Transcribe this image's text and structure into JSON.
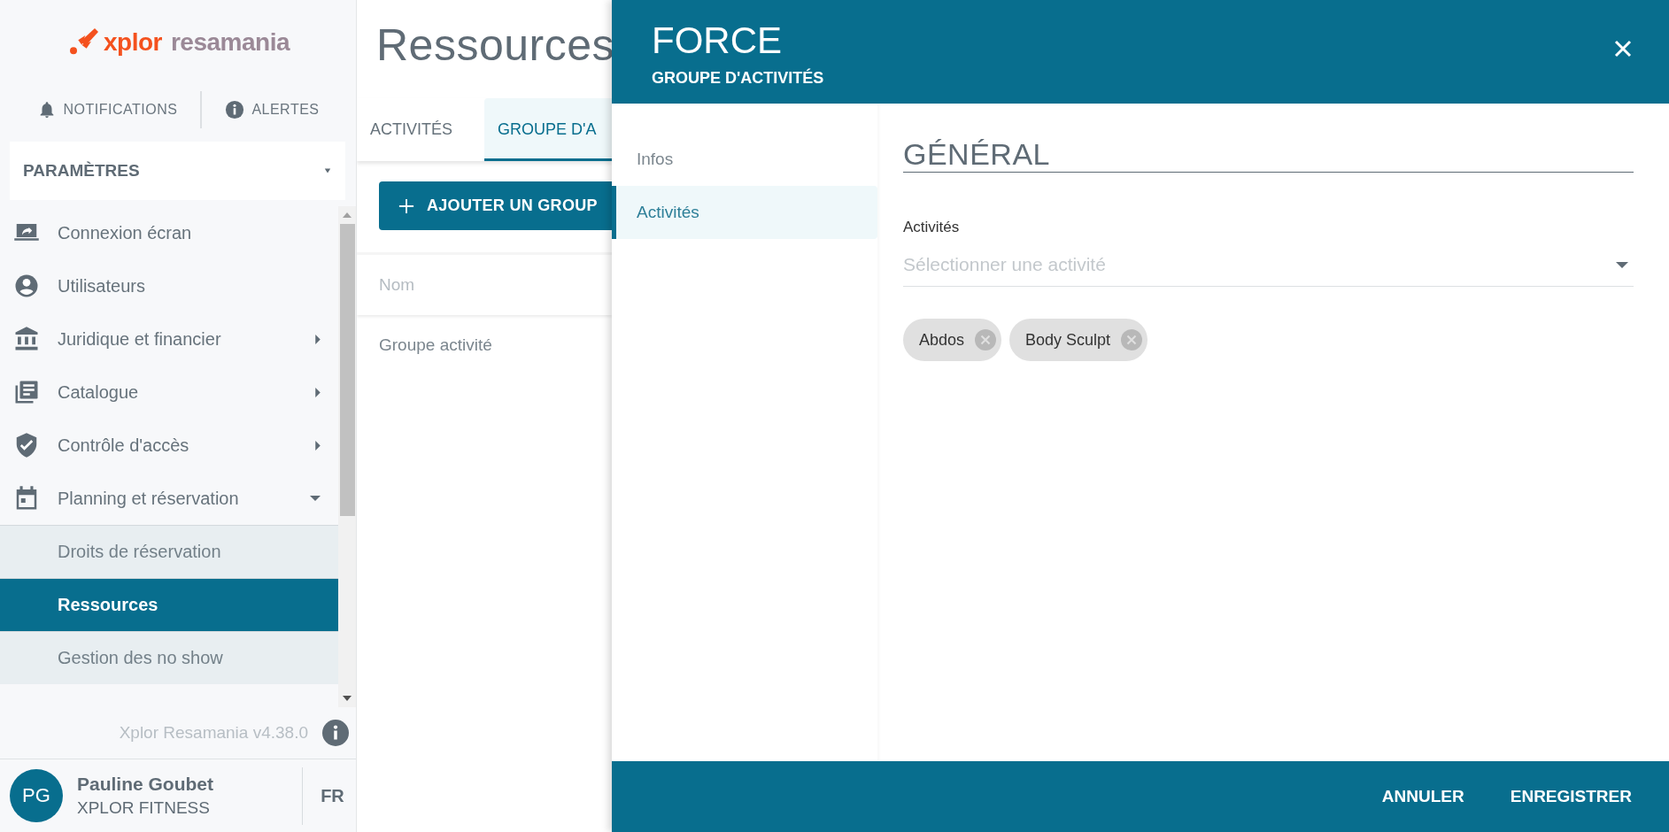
{
  "sidebar": {
    "logo": {
      "brand": "xplor",
      "product": "resamania"
    },
    "top_links": [
      {
        "label": "NOTIFICATIONS"
      },
      {
        "label": "ALERTES"
      }
    ],
    "section_select": {
      "value": "PARAMÈTRES"
    },
    "menu": [
      {
        "label": "Connexion écran",
        "kind": "link"
      },
      {
        "label": "Utilisateurs",
        "kind": "link"
      },
      {
        "label": "Juridique et financier",
        "kind": "group",
        "expanded": false
      },
      {
        "label": "Catalogue",
        "kind": "group",
        "expanded": false
      },
      {
        "label": "Contrôle d'accès",
        "kind": "group",
        "expanded": false
      },
      {
        "label": "Planning et réservation",
        "kind": "group",
        "expanded": true,
        "children": [
          {
            "label": "Droits de réservation",
            "selected": false
          },
          {
            "label": "Ressources",
            "selected": true
          },
          {
            "label": "Gestion des no show",
            "selected": false
          }
        ]
      }
    ],
    "version": "Xplor Resamania v4.38.0",
    "user": {
      "initials": "PG",
      "name": "Pauline Goubet",
      "organization": "XPLOR FITNESS",
      "language": "FR"
    }
  },
  "main": {
    "title": "Ressources",
    "tabs": [
      {
        "label": "ACTIVITÉS",
        "selected": false
      },
      {
        "label": "GROUPE D'A",
        "selected": true
      }
    ],
    "add_button": "AJOUTER UN GROUP",
    "table": {
      "columns": [
        "Nom"
      ],
      "rows": [
        [
          "Groupe activité"
        ]
      ]
    }
  },
  "panel": {
    "title": "FORCE",
    "subtitle": "GROUPE D'ACTIVITÉS",
    "nav": [
      {
        "label": "Infos",
        "selected": false
      },
      {
        "label": "Activités",
        "selected": true
      }
    ],
    "section_title": "GÉNÉRAL",
    "field": {
      "label": "Activités",
      "placeholder": "Sélectionner une activité"
    },
    "chips": [
      "Abdos",
      "Body Sculpt"
    ],
    "buttons": [
      "ANNULER",
      "ENREGISTRER"
    ]
  }
}
